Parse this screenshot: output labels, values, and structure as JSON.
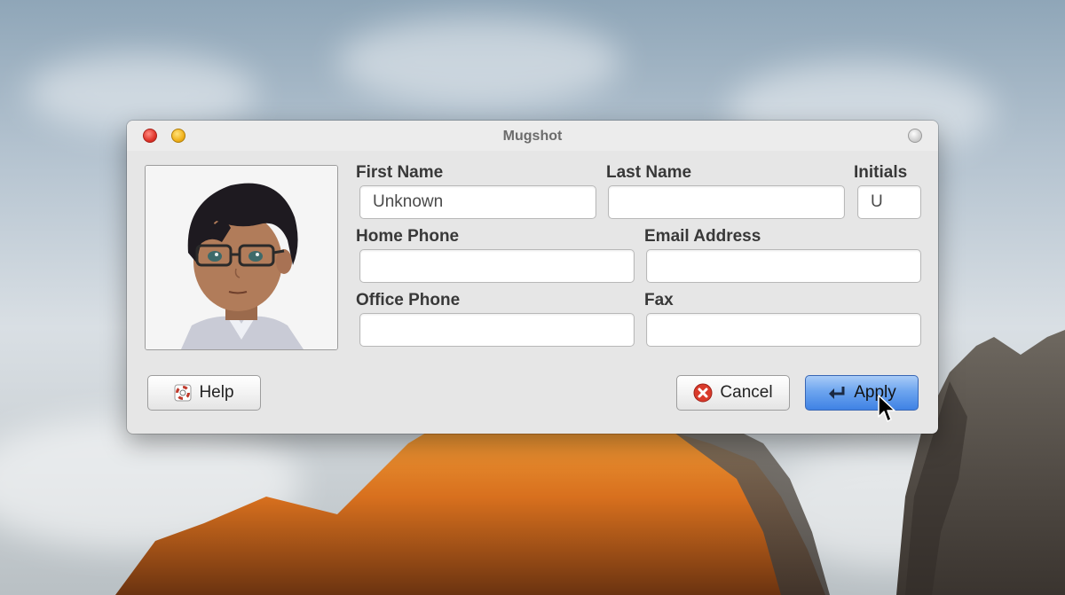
{
  "window": {
    "title": "Mugshot"
  },
  "form": {
    "first_name": {
      "label": "First Name",
      "value": "Unknown",
      "placeholder": ""
    },
    "last_name": {
      "label": "Last Name",
      "value": "",
      "placeholder": ""
    },
    "initials": {
      "label": "Initials",
      "value": "U",
      "placeholder": ""
    },
    "home_phone": {
      "label": "Home Phone",
      "value": "",
      "placeholder": ""
    },
    "email": {
      "label": "Email Address",
      "value": "",
      "placeholder": ""
    },
    "office_phone": {
      "label": "Office Phone",
      "value": "",
      "placeholder": ""
    },
    "fax": {
      "label": "Fax",
      "value": "",
      "placeholder": ""
    }
  },
  "buttons": {
    "help": "Help",
    "cancel": "Cancel",
    "apply": "Apply"
  },
  "icons": {
    "help": "lifebuoy-icon",
    "cancel": "red-x-circle-icon",
    "apply": "return-arrow-icon",
    "avatar": "user-avatar-image"
  },
  "colors": {
    "apply_button": "#4f8fe8",
    "close_light": "#e0352b",
    "minimize_light": "#f1b21c"
  }
}
